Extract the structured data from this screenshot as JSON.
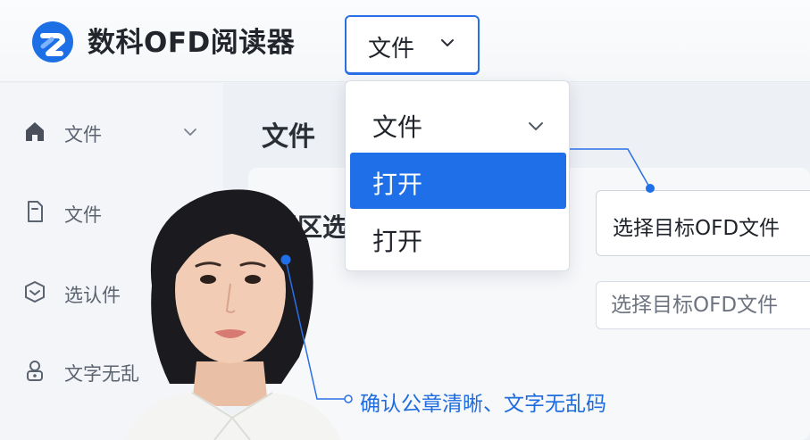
{
  "app": {
    "title": "数科OFD阅读器",
    "top_select_label": "文件"
  },
  "sidebar": {
    "items": [
      {
        "label": "文件",
        "icon": "home-icon"
      },
      {
        "label": "文件",
        "icon": "document-icon"
      },
      {
        "label": "选认件",
        "icon": "shield-check-icon"
      },
      {
        "label": "文字无乱",
        "icon": "user-lock-icon"
      }
    ]
  },
  "main": {
    "title": "文件",
    "card_heading": "程区选",
    "field_value": "选择目标OFD文件",
    "field_placeholder": "选择目标OFD文件"
  },
  "dropdown": {
    "items": [
      {
        "label": "文件",
        "selected": false
      },
      {
        "label": "打开",
        "selected": true
      },
      {
        "label": "打开",
        "selected": false
      }
    ]
  },
  "annotation": {
    "text": "确认公章清晰、文字无乱码"
  },
  "colors": {
    "accent": "#1f6fe8",
    "annotation": "#1e6ce0",
    "sidebar_bg": "#f3f5f8"
  }
}
